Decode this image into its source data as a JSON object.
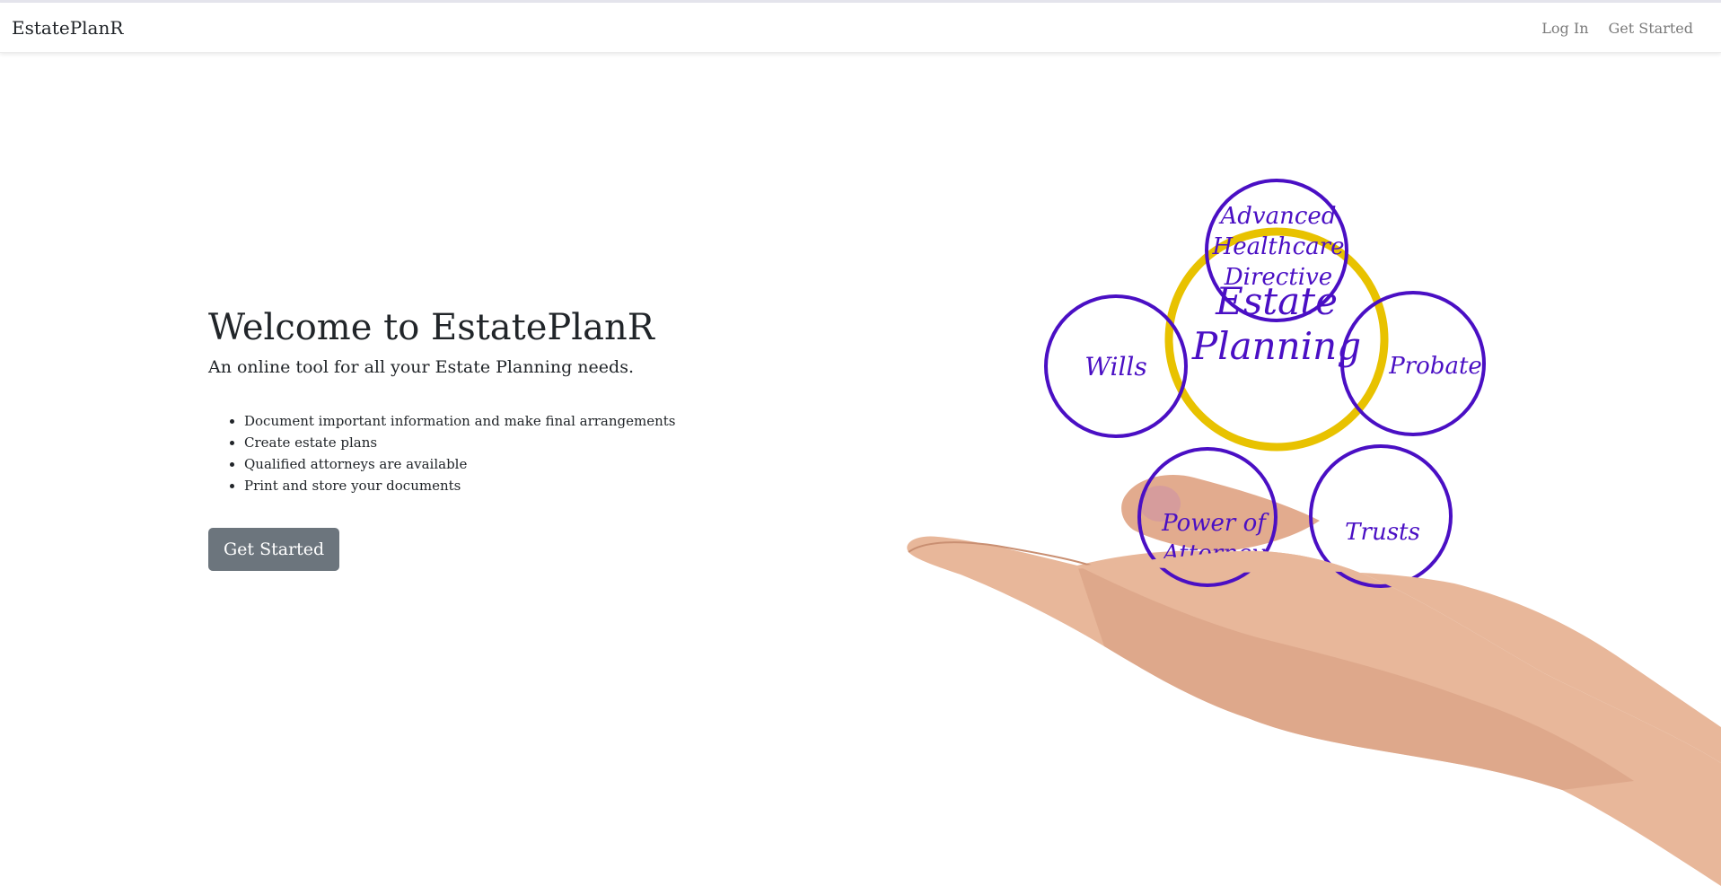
{
  "navbar": {
    "brand": "EstatePlanR",
    "links": [
      {
        "label": "Log In"
      },
      {
        "label": "Get Started"
      }
    ]
  },
  "hero": {
    "title": "Welcome to EstatePlanR",
    "lead": "An online tool for all your Estate Planning needs.",
    "features": [
      "Document important information and make final arrangements",
      "Create estate plans",
      "Qualified attorneys are available",
      "Print and store your documents"
    ],
    "cta_label": "Get Started"
  },
  "illustration": {
    "center": [
      "Estate",
      "Planning"
    ],
    "top": [
      "Advanced",
      "Healthcare",
      "Directive"
    ],
    "left": "Wills",
    "right": "Probate",
    "bottom_left": [
      "Power of",
      "Attorney"
    ],
    "bottom_right": "Trusts",
    "colors": {
      "circle": "#4a0fc4",
      "center_ring": "#e8c200",
      "skin": "#e8b79a"
    }
  }
}
